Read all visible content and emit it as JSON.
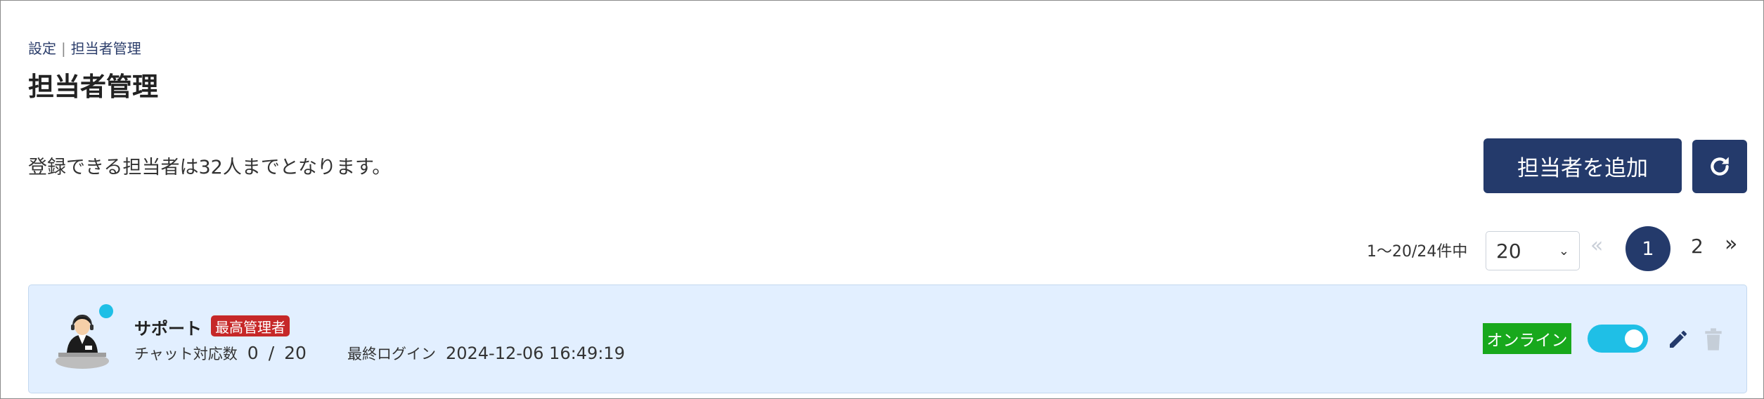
{
  "breadcrumb": {
    "parent": "設定",
    "current": "担当者管理"
  },
  "page": {
    "title": "担当者管理"
  },
  "notice": {
    "text": "登録できる担当者は32人までとなります。"
  },
  "toolbar": {
    "add_label": "担当者を追加",
    "refresh_icon": "refresh-icon"
  },
  "pagination": {
    "range_text": "1～20/24件中",
    "per_page": "20",
    "first": "«",
    "pages": [
      "1",
      "2"
    ],
    "current_page": "1",
    "last": "»"
  },
  "users": [
    {
      "name": "サポート",
      "role_badge": "最高管理者",
      "chat_label": "チャット対応数",
      "chat_current": "0",
      "chat_sep": "/",
      "chat_max": "20",
      "last_login_label": "最終ログイン",
      "last_login": "2024-12-06 16:49:19",
      "status": "オンライン",
      "status_color": "#18a81c",
      "toggle_on": true
    }
  ],
  "colors": {
    "primary": "#243a6b",
    "accent": "#1fbfe6",
    "danger": "#c62828",
    "card_bg": "#e2efff"
  }
}
